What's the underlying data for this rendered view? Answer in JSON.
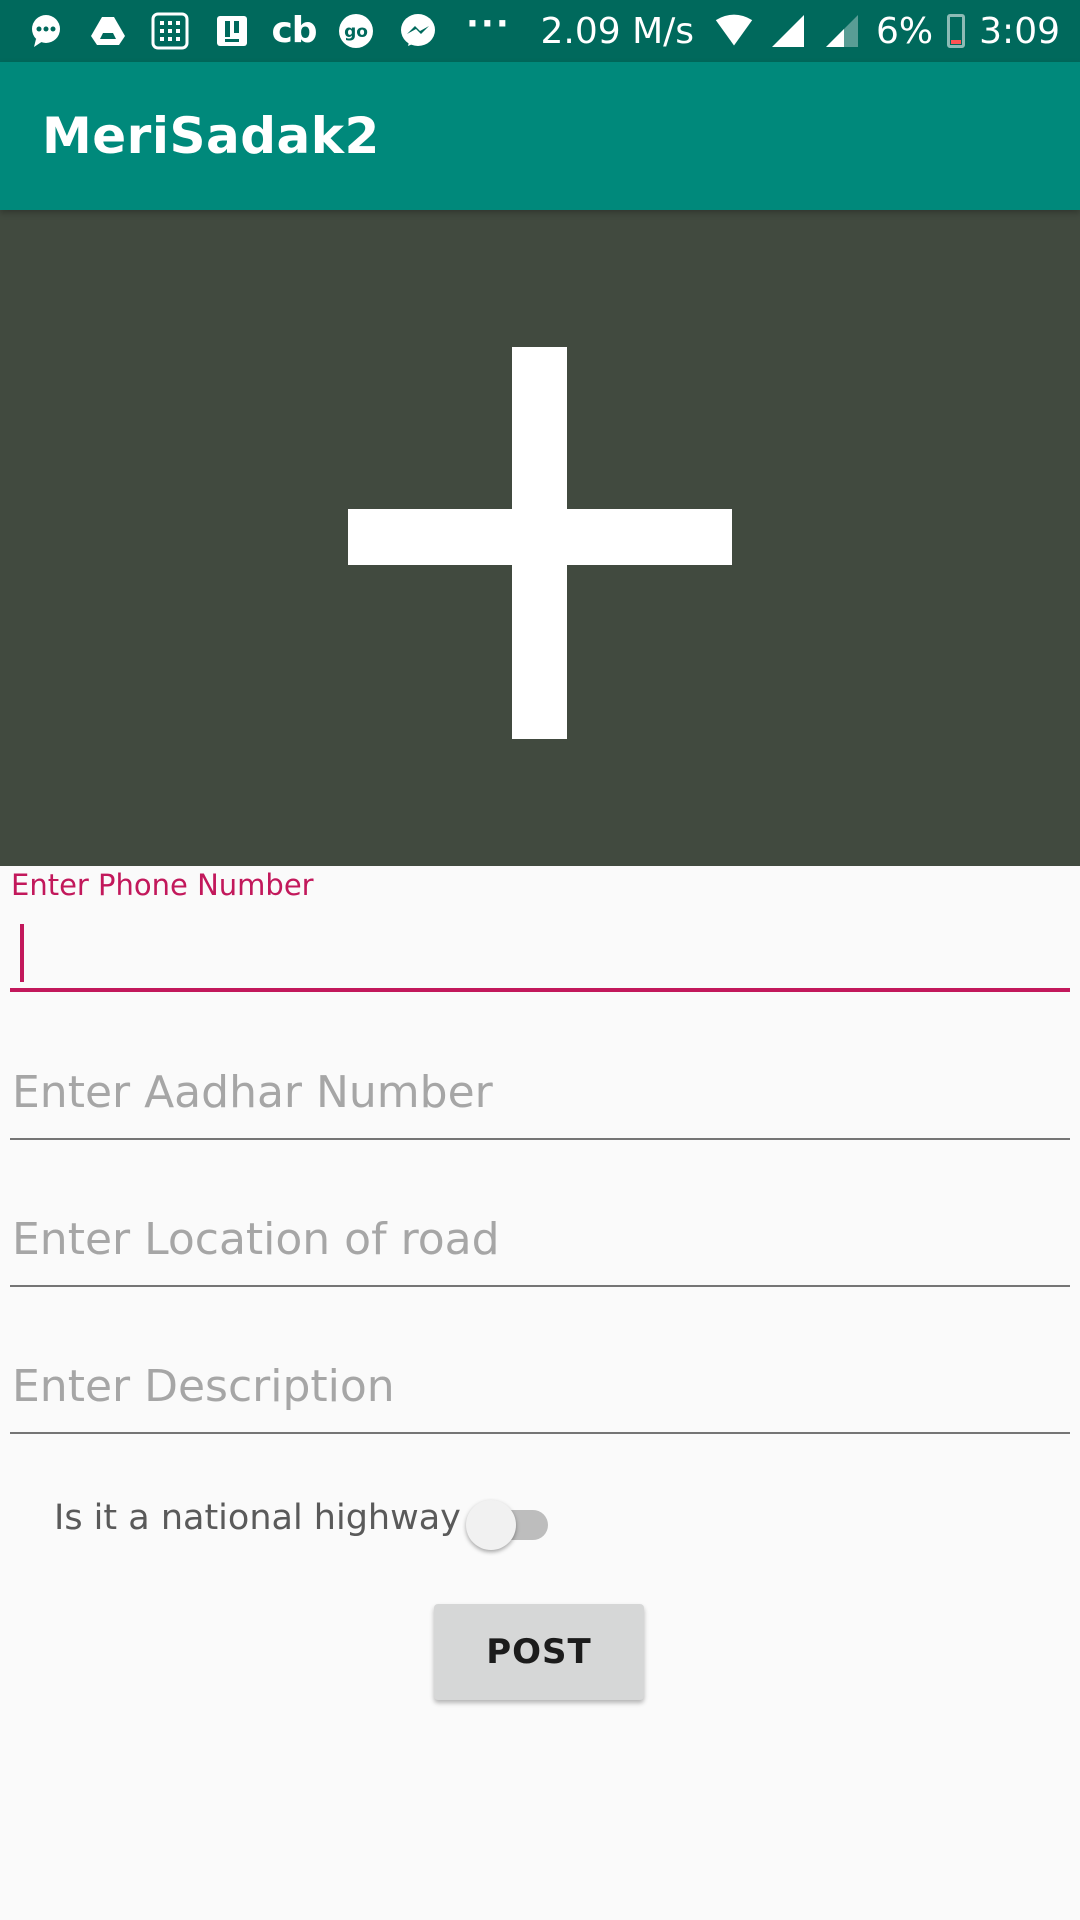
{
  "status_bar": {
    "icons": [
      "chat-bubble-icon",
      "drive-icon",
      "calculator-icon",
      "notification-icon",
      "cricbuzz-icon",
      "goibibo-icon",
      "messenger-icon",
      "more-notifications-icon"
    ],
    "cb_text": "cb",
    "go_text": "go",
    "overflow_dots": "···",
    "network_speed": "2.09 M/s",
    "battery_percent": "6%",
    "time": "3:09"
  },
  "app_bar": {
    "title": "MeriSadak2"
  },
  "image_picker": {
    "icon": "plus-icon"
  },
  "form": {
    "phone": {
      "label": "Enter Phone Number",
      "value": ""
    },
    "aadhar": {
      "placeholder": "Enter Aadhar Number"
    },
    "location": {
      "placeholder": "Enter Location of road"
    },
    "description": {
      "placeholder": "Enter Description"
    },
    "national_highway": {
      "label": "Is it a national highway",
      "checked": false
    },
    "post_label": "POST"
  },
  "colors": {
    "status_bar": "#00695c",
    "app_bar": "#00897b",
    "accent": "#c2185b",
    "image_area": "#414a3f"
  }
}
